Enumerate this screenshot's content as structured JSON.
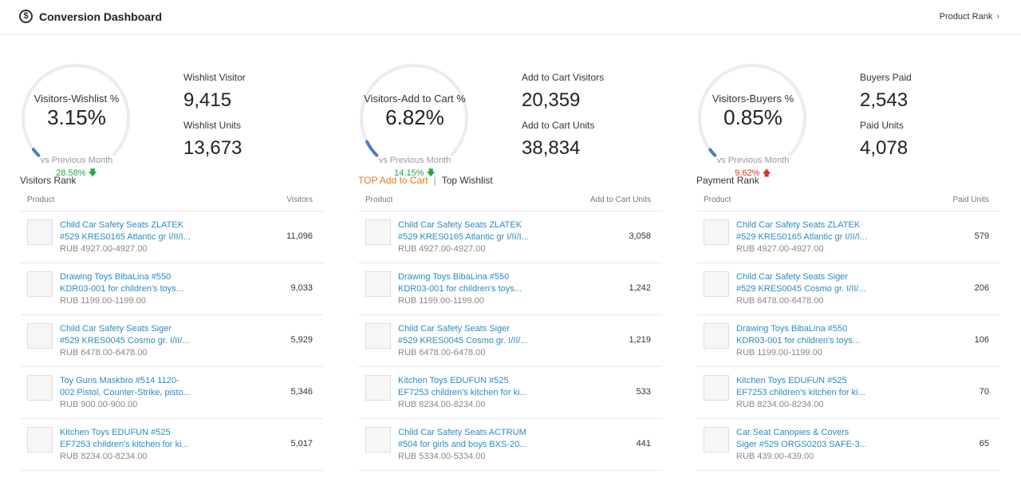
{
  "header": {
    "title": "Conversion Dashboard",
    "logo_icon": "dollar-circle-icon",
    "product_rank_link": "Product Rank",
    "chevron": "›"
  },
  "sections": [
    {
      "gauge": {
        "label": "Visitors-Wishlist %",
        "value": "3.15%",
        "fraction": 0.0315,
        "vs": "vs Previous Month",
        "change": "28.58%",
        "direction": "down",
        "arrow": "🡇"
      },
      "metrics": [
        {
          "label": "Wishlist Visitor",
          "value": "9,415"
        },
        {
          "label": "Wishlist Units",
          "value": "13,673"
        }
      ],
      "rank": {
        "title": "Visitors Rank"
      },
      "table": {
        "col_product": "Product",
        "col_value": "Visitors",
        "rows": [
          {
            "icon": "car-seat-grey-thumb",
            "name1": "Child Car Safety Seats ZLATEK",
            "name2": "#529 KRES0165 Atlantic gr I/II/I...",
            "price": "RUB 4927.00-4927.00",
            "value": "11,096"
          },
          {
            "icon": "drawing-toys-thumb",
            "name1": "Drawing Toys BibaLina #550",
            "name2": "KDR03-001 for children's toys...",
            "price": "RUB 1199.00-1199.00",
            "value": "9,033"
          },
          {
            "icon": "car-seat-blue-thumb",
            "name1": "Child Car Safety Seats Siger",
            "name2": "#529 KRES0045 Cosmo gr. I/II/...",
            "price": "RUB 6478.00-6478.00",
            "value": "5,929"
          },
          {
            "icon": "toy-gun-thumb",
            "name1": "Toy Guns Maskbro #514 1120-",
            "name2": "002 Pistol, Counter-Strike, pisto...",
            "price": "RUB 900.00-900.00",
            "value": "5,346"
          },
          {
            "icon": "kitchen-toy-thumb",
            "name1": "Kitchen Toys EDUFUN #525",
            "name2": "EF7253 children's kitchen for ki...",
            "price": "RUB 8234.00-8234.00",
            "value": "5,017"
          }
        ]
      }
    },
    {
      "gauge": {
        "label": "Visitors-Add to Cart %",
        "value": "6.82%",
        "fraction": 0.0682,
        "vs": "vs Previous Month",
        "change": "14.15%",
        "direction": "down",
        "arrow": "🡇"
      },
      "metrics": [
        {
          "label": "Add to Cart Visitors",
          "value": "20,359"
        },
        {
          "label": "Add to Cart Units",
          "value": "38,834"
        }
      ],
      "rank": {
        "active": "TOP Add to Cart",
        "sep": "|",
        "inactive": "Top Wishlist"
      },
      "table": {
        "col_product": "Product",
        "col_value": "Add to Cart Units",
        "rows": [
          {
            "icon": "car-seat-grey-thumb",
            "name1": "Child Car Safety Seats ZLATEK",
            "name2": "#529 KRES0165 Atlantic gr I/II/I...",
            "price": "RUB 4927.00-4927.00",
            "value": "3,058"
          },
          {
            "icon": "drawing-toys-thumb",
            "name1": "Drawing Toys BibaLina #550",
            "name2": "KDR03-001 for children's toys...",
            "price": "RUB 1199.00-1199.00",
            "value": "1,242"
          },
          {
            "icon": "car-seat-blue-thumb",
            "name1": "Child Car Safety Seats Siger",
            "name2": "#529 KRES0045 Cosmo gr. I/II/...",
            "price": "RUB 6478.00-6478.00",
            "value": "1,219"
          },
          {
            "icon": "kitchen-toy-thumb",
            "name1": "Kitchen Toys EDUFUN #525",
            "name2": "EF7253 children's kitchen for ki...",
            "price": "RUB 8234.00-8234.00",
            "value": "533"
          },
          {
            "icon": "car-seat-black-thumb",
            "name1": "Child Car Safety Seats ACTRUM",
            "name2": "#504 for girls and boys BXS-20...",
            "price": "RUB 5334.00-5334.00",
            "value": "441"
          }
        ]
      }
    },
    {
      "gauge": {
        "label": "Visitors-Buyers %",
        "value": "0.85%",
        "fraction": 0.0085,
        "vs": "vs Previous Month",
        "change": "9.62%",
        "direction": "up",
        "arrow": "🡅"
      },
      "metrics": [
        {
          "label": "Buyers Paid",
          "value": "2,543"
        },
        {
          "label": "Paid Units",
          "value": "4,078"
        }
      ],
      "rank": {
        "title": "Payment Rank"
      },
      "table": {
        "col_product": "Product",
        "col_value": "Paid Units",
        "rows": [
          {
            "icon": "car-seat-grey-thumb",
            "name1": "Child Car Safety Seats ZLATEK",
            "name2": "#529 KRES0165 Atlantic gr I/II/I...",
            "price": "RUB 4927.00-4927.00",
            "value": "579"
          },
          {
            "icon": "car-seat-blue-thumb",
            "name1": "Child Car Safety Seats Siger",
            "name2": "#529 KRES0045 Cosmo gr. I/II/...",
            "price": "RUB 6478.00-6478.00",
            "value": "206"
          },
          {
            "icon": "drawing-toys-thumb",
            "name1": "Drawing Toys BibaLina #550",
            "name2": "KDR03-001 for children's toys...",
            "price": "RUB 1199.00-1199.00",
            "value": "106"
          },
          {
            "icon": "kitchen-toy-thumb",
            "name1": "Kitchen Toys EDUFUN #525",
            "name2": "EF7253 children's kitchen for ki...",
            "price": "RUB 8234.00-8234.00",
            "value": "70"
          },
          {
            "icon": "car-seat-canopy-thumb",
            "name1": "Car Seat Canopies & Covers",
            "name2": "Siger #529 ORGS0203 SAFE-3...",
            "price": "RUB 439.00-439.00",
            "value": "65"
          }
        ]
      }
    }
  ],
  "colors": {
    "accent": "#e87a1f",
    "link": "#2b8bc1",
    "gauge_arc": "#4a7fc1",
    "down": "#27a844",
    "up": "#e0302a"
  }
}
